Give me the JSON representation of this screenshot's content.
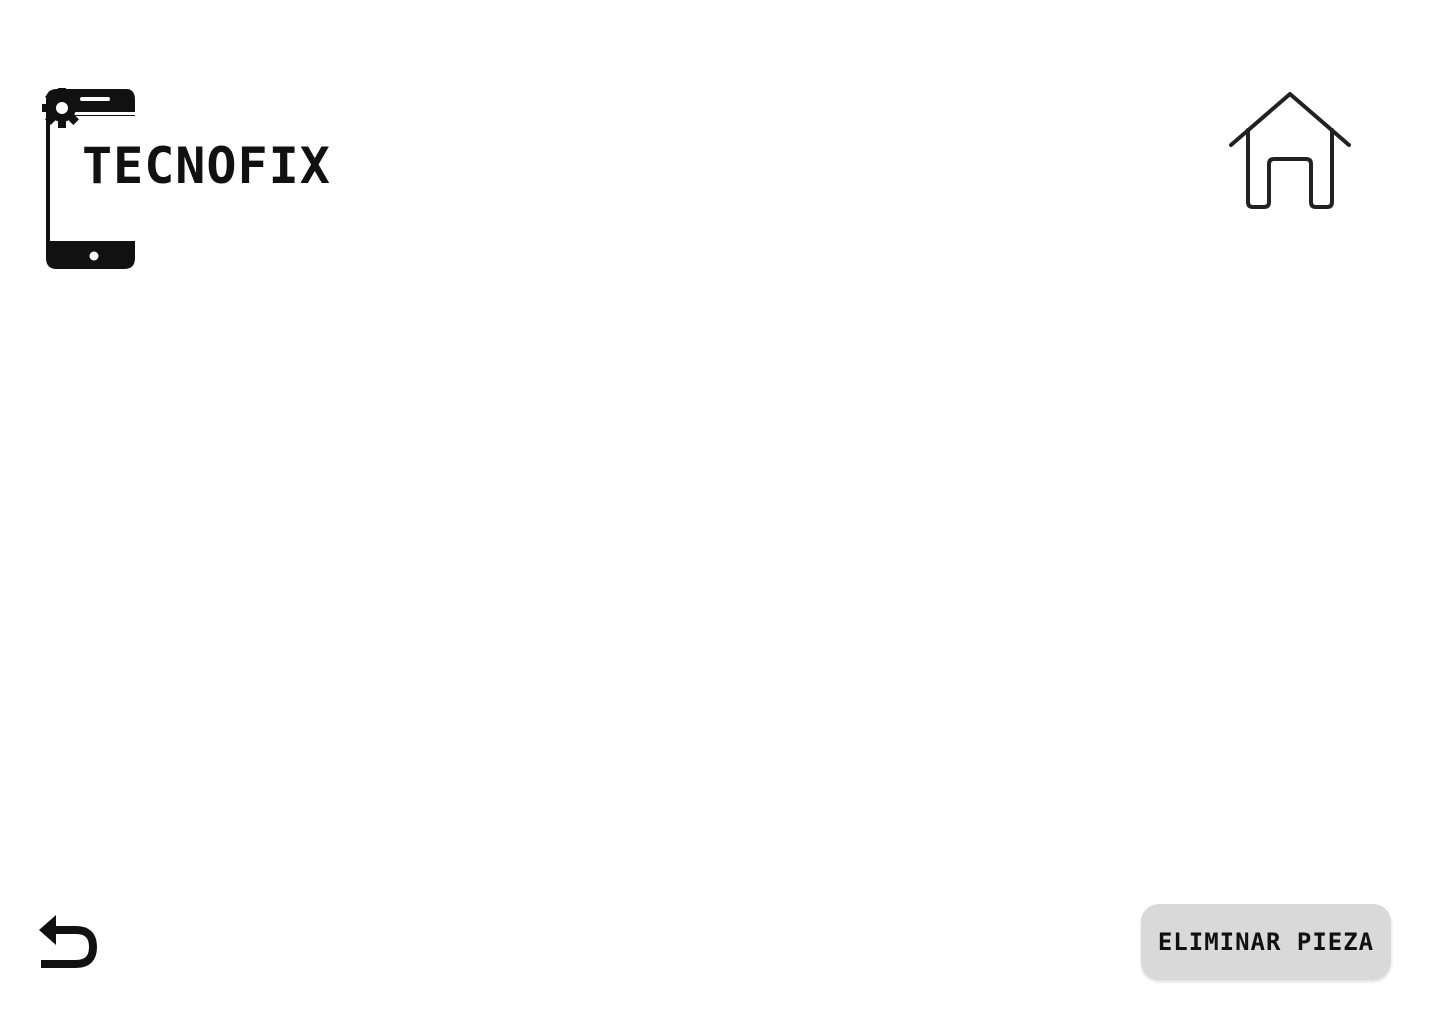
{
  "brand": {
    "name": "TECNOFIX",
    "logo_icon": "smartphone-icon",
    "gear_icon": "gear-icon"
  },
  "nav": {
    "home_icon": "home-icon",
    "back_icon": "back-arrow-icon"
  },
  "actions": {
    "delete_label": "ELIMINAR PIEZA"
  },
  "colors": {
    "background": "#ffffff",
    "foreground": "#111111",
    "button_background": "#d9d9d9"
  }
}
